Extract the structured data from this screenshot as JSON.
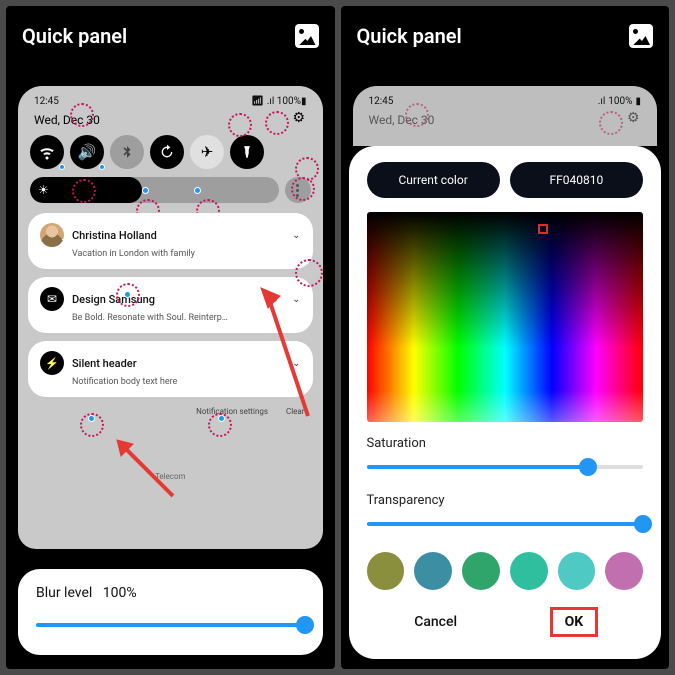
{
  "left": {
    "header": "Quick panel",
    "status": {
      "time": "12:45",
      "battery": "100%"
    },
    "date": "Wed, Dec 30",
    "toggles": [
      {
        "icon": "wifi",
        "glyph": "⦿",
        "on": true
      },
      {
        "icon": "sound",
        "glyph": "🔊",
        "on": true
      },
      {
        "icon": "bluetooth",
        "glyph": "฿",
        "on": false
      },
      {
        "icon": "rotate",
        "glyph": "⟳",
        "on": true
      },
      {
        "icon": "airplane",
        "glyph": "✈",
        "on": false
      },
      {
        "icon": "flashlight",
        "glyph": "🔦",
        "on": false
      }
    ],
    "brightness_glyph": "☀",
    "notifications": [
      {
        "title": "Christina Holland",
        "body": "Vacation in London with family",
        "avatar": true
      },
      {
        "title": "Design Samsung",
        "body": "Be Bold. Resonate with Soul. Reinterp…",
        "icon": "mail"
      },
      {
        "title": "Silent header",
        "body": "Notification body text here",
        "icon": "bolt"
      }
    ],
    "actions": {
      "settings": "Notification settings",
      "clear": "Clear"
    },
    "carrier": "Telecom",
    "blur": {
      "label": "Blur level",
      "value": "100%",
      "pct": 100
    }
  },
  "right": {
    "header": "Quick panel",
    "status": {
      "time": "12:45",
      "battery": "100%"
    },
    "date": "Wed, Dec 30",
    "picker": {
      "current_label": "Current color",
      "hex": "FF040810",
      "saturation_label": "Saturation",
      "saturation_pct": 80,
      "transparency_label": "Transparency",
      "transparency_pct": 100,
      "swatches": [
        "#8a8f3e",
        "#3c8fa3",
        "#2fa56b",
        "#2fbf9e",
        "#4fc9c4",
        "#c26fb0"
      ],
      "cancel": "Cancel",
      "ok": "OK"
    }
  }
}
